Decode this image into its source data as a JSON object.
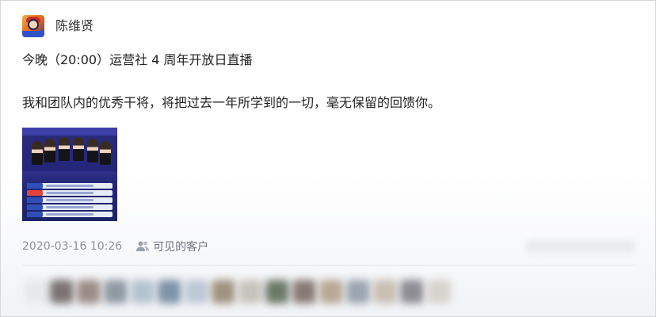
{
  "post": {
    "username": "陈维贤",
    "headline": "今晚（20:00）运营社 4 周年开放日直播",
    "body": "我和团队内的优秀干将，将把过去一年所学到的一切，毫无保留的回馈你。",
    "timestamp": "2020-03-16 10:26",
    "visibility": "可见的客户"
  },
  "icons": {
    "avatar": "avatar-cartoon-icon",
    "visibility": "people-icon",
    "poster": "livestream-poster-image"
  },
  "colors": {
    "text": "#222222",
    "meta": "#8a8f99",
    "poster_bg": "#24267a"
  }
}
